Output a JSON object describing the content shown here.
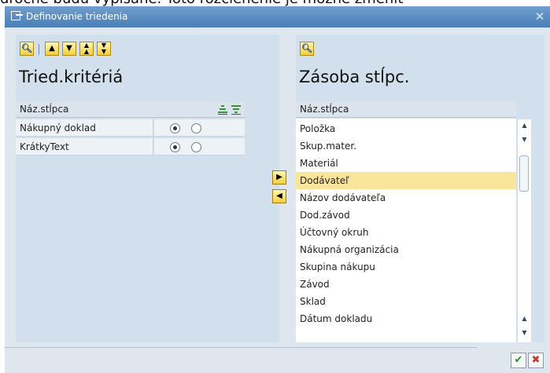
{
  "background_text": "dročné budú vypísané. Toto rozčlenenie je možné zmeniť",
  "window": {
    "title": "Definovanie triedenia",
    "close_glyph": "✕"
  },
  "left_panel": {
    "heading": "Tried.kritériá",
    "header_label": "Náz.stĺpca",
    "rows": [
      {
        "label": "Nákupný doklad",
        "ascending": true
      },
      {
        "label": "KrátkyText",
        "ascending": true
      }
    ],
    "toolbar_icons": [
      "find-icon",
      "up-icon",
      "down-icon",
      "top-icon",
      "bottom-icon"
    ],
    "sort_icons": [
      "sort-ascending-icon",
      "sort-descending-icon"
    ]
  },
  "right_panel": {
    "heading": "Zásoba stĺpc.",
    "header_label": "Náz.stĺpca",
    "items": [
      "Položka",
      "Skup.mater.",
      "Materiál",
      "Dodávateľ",
      "Názov dodávateľa",
      "Dod.závod",
      "Účtovný okruh",
      "Nákupná organizácia",
      "Skupina nákupu",
      "Závod",
      "Sklad",
      "Dátum dokladu"
    ],
    "selected_item": "Dodávateľ"
  },
  "footer": {
    "confirm_icon": "checkmark-icon",
    "cancel_icon": "cancel-icon"
  },
  "colors": {
    "accent": "#4a7eb6",
    "selected_row": "#fbe59a",
    "panel": "#d2dfec"
  }
}
